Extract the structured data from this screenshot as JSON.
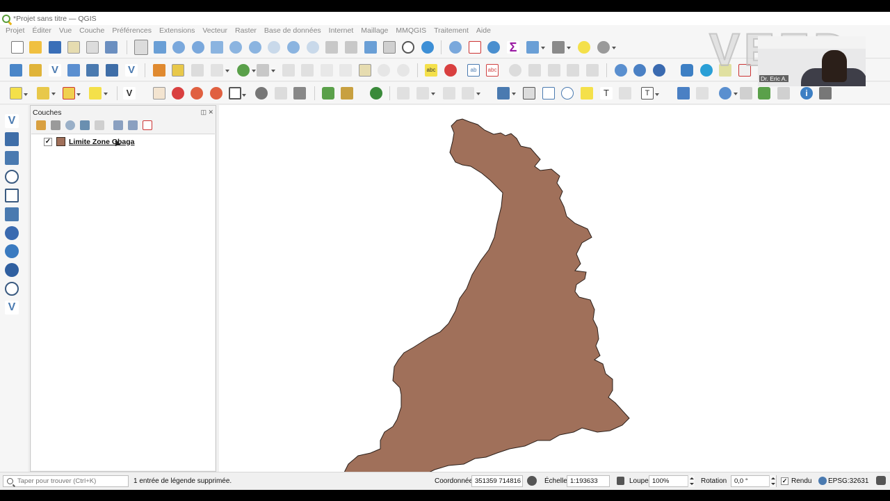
{
  "window": {
    "title": "*Projet sans titre — QGIS"
  },
  "menu": [
    "Projet",
    "Éditer",
    "Vue",
    "Couche",
    "Préférences",
    "Extensions",
    "Vecteur",
    "Raster",
    "Base de données",
    "Internet",
    "Maillage",
    "MMQGIS",
    "Traitement",
    "Aide"
  ],
  "layers_panel": {
    "title": "Couches",
    "layers": [
      {
        "name": "Limite Zone Gbaga",
        "checked": true,
        "fill_color": "#a0705a"
      }
    ]
  },
  "map": {
    "polygon_fill": "#a0705a",
    "polygon_stroke": "#2a1f1a"
  },
  "status": {
    "search_placeholder": "Taper pour trouver (Ctrl+K)",
    "message": "1 entrée de légende supprimée.",
    "coordinate_label": "Coordonnée",
    "coordinate_value": "351359  714816",
    "scale_label": "Échelle",
    "scale_value": "1:193633",
    "magnifier_label": "Loupe",
    "magnifier_value": "100%",
    "rotation_label": "Rotation",
    "rotation_value": "0,0 °",
    "render_label": "Rendu",
    "crs": "EPSG:32631"
  },
  "overlay": {
    "watermark": "VEED",
    "presenter_name": "Dr. Eric A."
  },
  "colors": {
    "accent_green": "#5a9e3a",
    "accent_blue": "#3d7fc4",
    "accent_yellow": "#e7b416"
  }
}
